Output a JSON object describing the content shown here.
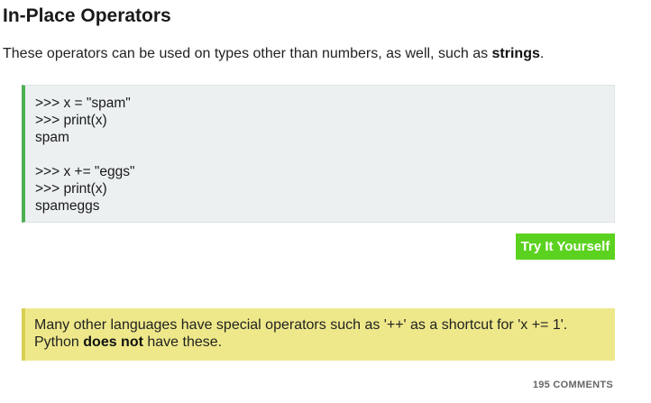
{
  "lesson": {
    "title": "In-Place Operators",
    "intro_before": "These operators can be used on types other than numbers, as well, such as ",
    "intro_bold": "strings",
    "intro_after": "."
  },
  "code": {
    "lines": [
      ">>> x = \"spam\"",
      ">>> print(x)",
      "spam",
      "",
      ">>> x += \"eggs\"",
      ">>> print(x)",
      "spameggs"
    ]
  },
  "actions": {
    "try_label": "Try It Yourself"
  },
  "note": {
    "line1": "Many other languages have special operators such as '++' as a shortcut for 'x += 1'.",
    "line2_before": "Python ",
    "line2_bold": "does not",
    "line2_after": " have these."
  },
  "footer": {
    "comments_label": "195 COMMENTS"
  },
  "colors": {
    "code_accent": "#4caf50",
    "code_background": "#ecf0f1",
    "button_background": "#5bd21f",
    "note_background": "#eee88a",
    "note_accent": "#d8cf52"
  }
}
